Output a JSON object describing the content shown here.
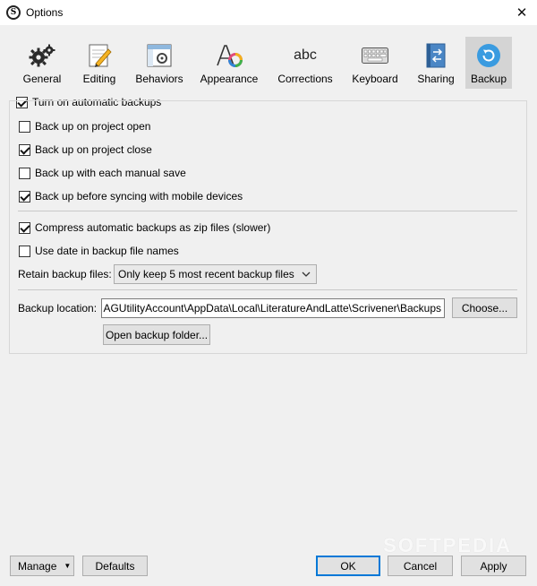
{
  "window": {
    "title": "Options",
    "close_glyph": "✕"
  },
  "toolbar": {
    "items": [
      {
        "label": "General",
        "icon": "gears-icon"
      },
      {
        "label": "Editing",
        "icon": "pencil-page-icon"
      },
      {
        "label": "Behaviors",
        "icon": "window-gear-icon"
      },
      {
        "label": "Appearance",
        "icon": "font-color-icon"
      },
      {
        "label": "Corrections",
        "icon": "abc-icon",
        "glyph": "abc"
      },
      {
        "label": "Keyboard",
        "icon": "keyboard-icon"
      },
      {
        "label": "Sharing",
        "icon": "sharing-icon"
      },
      {
        "label": "Backup",
        "icon": "backup-icon",
        "active": true
      }
    ]
  },
  "backup": {
    "turn_on_label": "Turn on automatic backups",
    "turn_on_checked": true,
    "options": [
      {
        "label": "Back up on project open",
        "checked": false
      },
      {
        "label": "Back up on project close",
        "checked": true
      },
      {
        "label": "Back up with each manual save",
        "checked": false
      },
      {
        "label": "Back up before syncing with mobile devices",
        "checked": true
      }
    ],
    "compress_label": "Compress automatic backups as zip files (slower)",
    "compress_checked": true,
    "use_date_label": "Use date in backup file names",
    "use_date_checked": false,
    "retain_label": "Retain backup files:",
    "retain_value": "Only keep 5 most recent backup files",
    "location_label": "Backup location:",
    "location_value": "AGUtilityAccount\\AppData\\Local\\LiteratureAndLatte\\Scrivener\\Backups",
    "choose_label": "Choose...",
    "open_folder_label": "Open backup folder..."
  },
  "footer": {
    "manage_label": "Manage",
    "defaults_label": "Defaults",
    "ok_label": "OK",
    "cancel_label": "Cancel",
    "apply_label": "Apply"
  },
  "watermark": "SOFTPEDIA",
  "colors": {
    "accent": "#0078d7",
    "backup_icon": "#3a9be0",
    "active_tab_bg": "#d4d4d4"
  }
}
